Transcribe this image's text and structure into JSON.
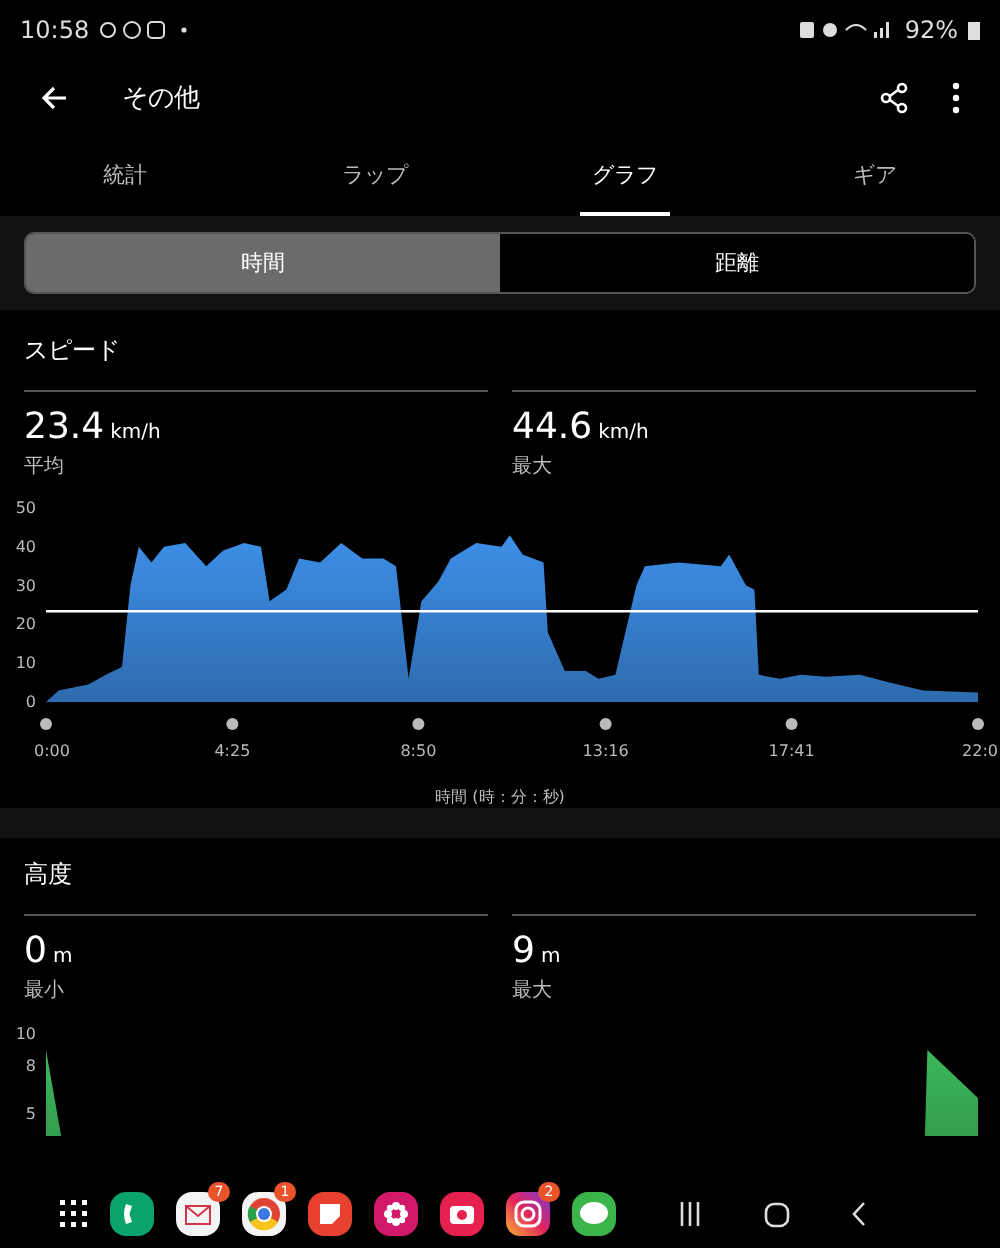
{
  "status_bar": {
    "time": "10:58",
    "battery": "92%"
  },
  "header": {
    "title": "その他"
  },
  "tabs": [
    {
      "label": "統計",
      "selected": false
    },
    {
      "label": "ラップ",
      "selected": false
    },
    {
      "label": "グラフ",
      "selected": true
    },
    {
      "label": "ギア",
      "selected": false
    }
  ],
  "segments": [
    {
      "label": "時間",
      "selected": true
    },
    {
      "label": "距離",
      "selected": false
    }
  ],
  "sections": [
    {
      "title": "スピード",
      "stats": [
        {
          "value": "23.4",
          "unit": "km/h",
          "label": "平均"
        },
        {
          "value": "44.6",
          "unit": "km/h",
          "label": "最大"
        }
      ],
      "chart_data": {
        "type": "area",
        "xlabel": "時間 (時：分：秒)",
        "xlim": [
          0,
          22.1
        ],
        "ylim": [
          0,
          50
        ],
        "yticks": [
          0,
          10,
          20,
          30,
          40,
          50
        ],
        "xticks": [
          {
            "value": 0,
            "label": "0:00"
          },
          {
            "value": 4.42,
            "label": "4:25"
          },
          {
            "value": 8.83,
            "label": "8:50"
          },
          {
            "value": 13.27,
            "label": "13:16"
          },
          {
            "value": 17.68,
            "label": "17:41"
          },
          {
            "value": 22.1,
            "label": "22:0"
          }
        ],
        "x": [
          0,
          0.3,
          1,
          1.5,
          1.8,
          2,
          2.2,
          2.5,
          2.8,
          3.3,
          3.8,
          4.2,
          4.7,
          5.1,
          5.3,
          5.7,
          6,
          6.5,
          7,
          7.5,
          8,
          8.3,
          8.6,
          8.9,
          9.3,
          9.6,
          10.2,
          10.8,
          11,
          11.3,
          11.8,
          11.9,
          12.3,
          12.8,
          13.1,
          13.5,
          14,
          14.2,
          15,
          16,
          16.2,
          16.6,
          16.8,
          16.9,
          17.4,
          17.9,
          18.5,
          19.3,
          20,
          20.8,
          22.1
        ],
        "series": [
          {
            "color": "#3d8fe8",
            "values": [
              0,
              3,
              4.5,
              7.5,
              9,
              30,
              40,
              36,
              40,
              41,
              35,
              39,
              41,
              40,
              26,
              29,
              37,
              36,
              41,
              37,
              37,
              35,
              6,
              26,
              31,
              37,
              41,
              40,
              43,
              38,
              36,
              18,
              8,
              8,
              6,
              7,
              30,
              35,
              36,
              35,
              38,
              30,
              29,
              7,
              6,
              7,
              6.5,
              7,
              5,
              3,
              2.5
            ]
          },
          {
            "type": "line",
            "color": "#ffffff",
            "values": [
              23.4,
              23.4,
              23.4,
              23.4,
              23.4,
              23.4,
              23.4,
              23.4,
              23.4,
              23.4,
              23.4,
              23.4,
              23.4,
              23.4,
              23.4,
              23.4,
              23.4,
              23.4,
              23.4,
              23.4,
              23.4,
              23.4,
              23.4,
              23.4,
              23.4,
              23.4,
              23.4,
              23.4,
              23.4,
              23.4,
              23.4,
              23.4,
              23.4,
              23.4,
              23.4,
              23.4,
              23.4,
              23.4,
              23.4,
              23.4,
              23.4,
              23.4,
              23.4,
              23.4,
              23.4,
              23.4,
              23.4,
              23.4,
              23.4,
              23.4,
              23.4
            ]
          }
        ]
      }
    },
    {
      "title": "高度",
      "stats": [
        {
          "value": "0",
          "unit": "m",
          "label": "最小"
        },
        {
          "value": "9",
          "unit": "m",
          "label": "最大"
        }
      ],
      "chart_data": {
        "type": "area",
        "xlim": [
          0,
          22.1
        ],
        "ylim": [
          0,
          10
        ],
        "yticks": [
          5,
          8,
          10
        ],
        "x": [
          0,
          0.6,
          20.8,
          20.9,
          22.1
        ],
        "series": [
          {
            "color": "#3cb85c",
            "values": [
              9,
              0,
              0,
              9,
              6
            ]
          }
        ]
      }
    }
  ],
  "dock": {
    "badges": [
      "7",
      "1",
      "2"
    ]
  }
}
